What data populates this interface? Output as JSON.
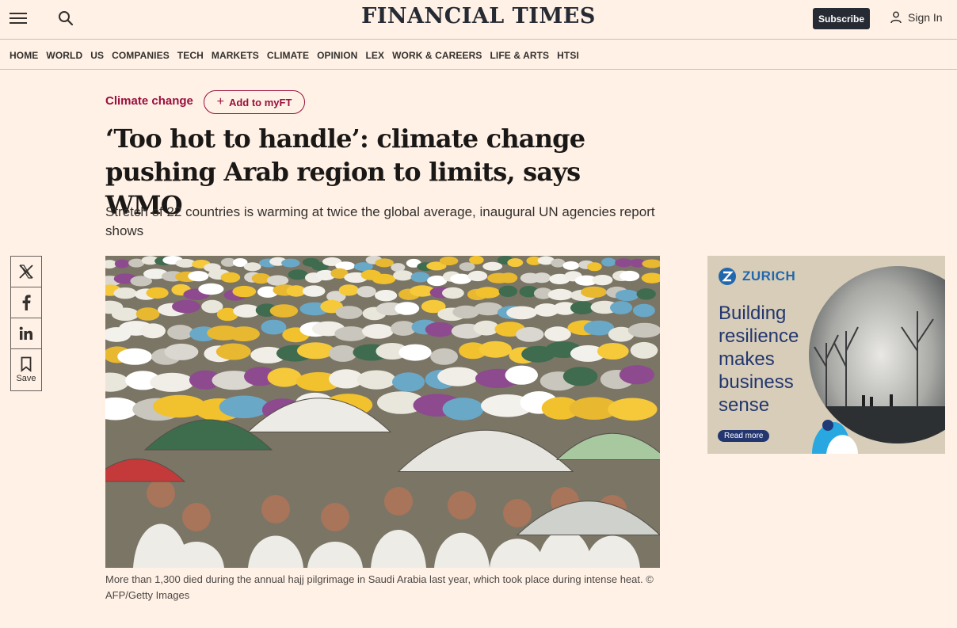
{
  "header": {
    "masthead": "FINANCIAL TIMES",
    "subscribe_label": "Subscribe",
    "signin_label": "Sign In"
  },
  "nav": {
    "items": [
      "HOME",
      "WORLD",
      "US",
      "COMPANIES",
      "TECH",
      "MARKETS",
      "CLIMATE",
      "OPINION",
      "LEX",
      "WORK & CAREERS",
      "LIFE & ARTS",
      "HTSI"
    ]
  },
  "article": {
    "topic": "Climate change",
    "myft_label": "Add to myFT",
    "headline": "‘Too hot to handle’: climate change pushing Arab region to limits, says WMO",
    "standfirst": "Stretch of 22 countries is warming at twice the global average, inaugural UN agencies report shows",
    "image_caption": "More than 1,300 died during the annual hajj pilgrimage in Saudi Arabia last year, which took place during intense heat. © AFP/Getty Images"
  },
  "share": {
    "save_label": "Save"
  },
  "ad": {
    "brand": "ZURICH",
    "text_lines": [
      "Building",
      "resilience",
      "makes",
      "business",
      "sense"
    ],
    "button_label": "Read more"
  },
  "colors": {
    "page_bg": "#fff1e5",
    "claret": "#990f3d",
    "dark": "#262a33",
    "zurich_blue": "#2167ae"
  }
}
